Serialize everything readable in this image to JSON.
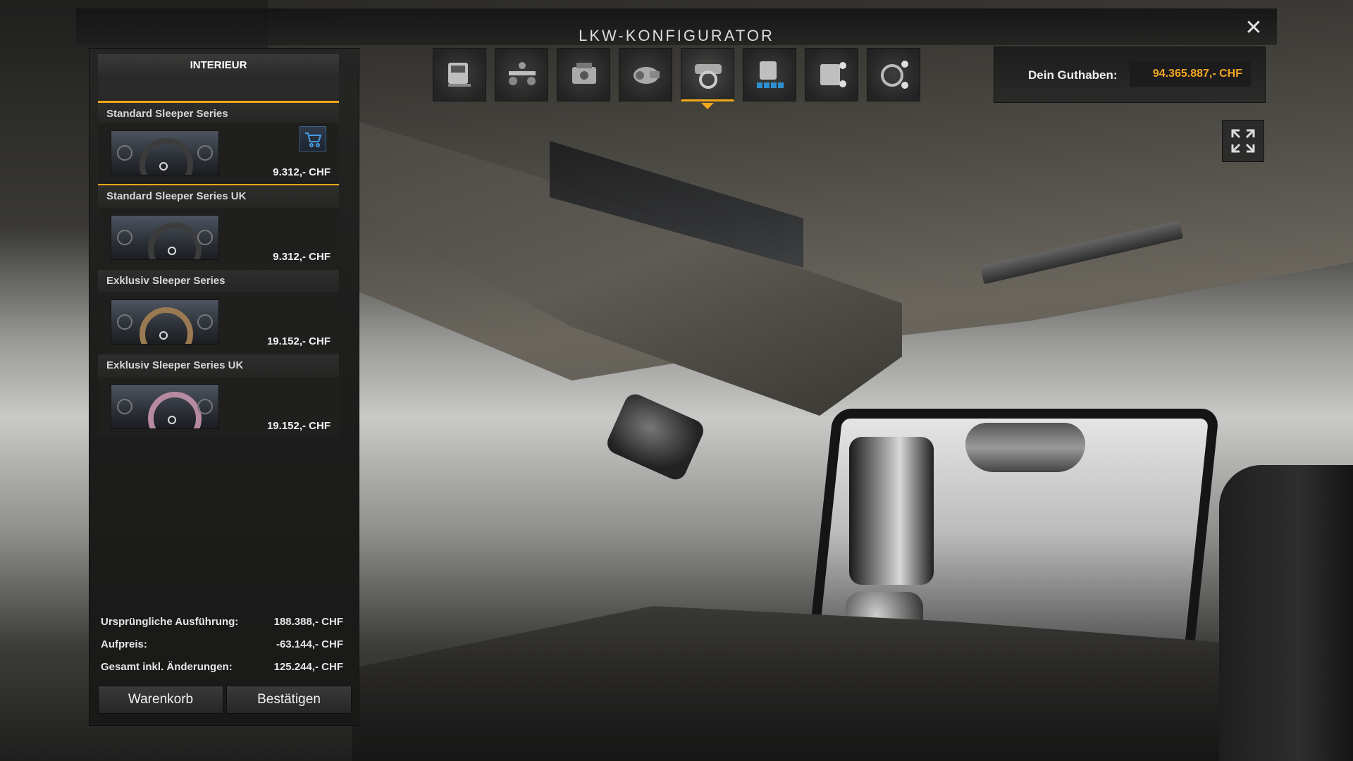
{
  "window": {
    "title": "LKW-KONFIGURATOR"
  },
  "toolbar": {
    "icons": [
      "truck-icon",
      "chassis-icon",
      "engine-icon",
      "transmission-icon",
      "interior-icon",
      "cabin-icon",
      "accessories-icon",
      "interior-accessories-icon"
    ],
    "active_index": 4
  },
  "balance": {
    "label": "Dein Guthaben:",
    "value": "94.365.887,- CHF"
  },
  "sidebar": {
    "header": "INTERIEUR",
    "items": [
      {
        "name": "Standard Sleeper Series",
        "price": "9.312,- CHF",
        "selected": true,
        "in_cart": true
      },
      {
        "name": "Standard Sleeper Series UK",
        "price": "9.312,- CHF",
        "selected": false,
        "in_cart": false
      },
      {
        "name": "Exklusiv Sleeper Series",
        "price": "19.152,- CHF",
        "selected": false,
        "in_cart": false
      },
      {
        "name": "Exklusiv Sleeper Series UK",
        "price": "19.152,- CHF",
        "selected": false,
        "in_cart": false
      }
    ]
  },
  "summary": {
    "original_label": "Ursprüngliche Ausführung:",
    "original_value": "188.388,- CHF",
    "surcharge_label": "Aufpreis:",
    "surcharge_value": "-63.144,- CHF",
    "total_label": "Gesamt inkl. Änderungen:",
    "total_value": "125.244,- CHF"
  },
  "buttons": {
    "cart": "Warenkorb",
    "confirm": "Bestätigen"
  },
  "colors": {
    "accent": "#f0a81a",
    "balance": "#f5a623"
  }
}
